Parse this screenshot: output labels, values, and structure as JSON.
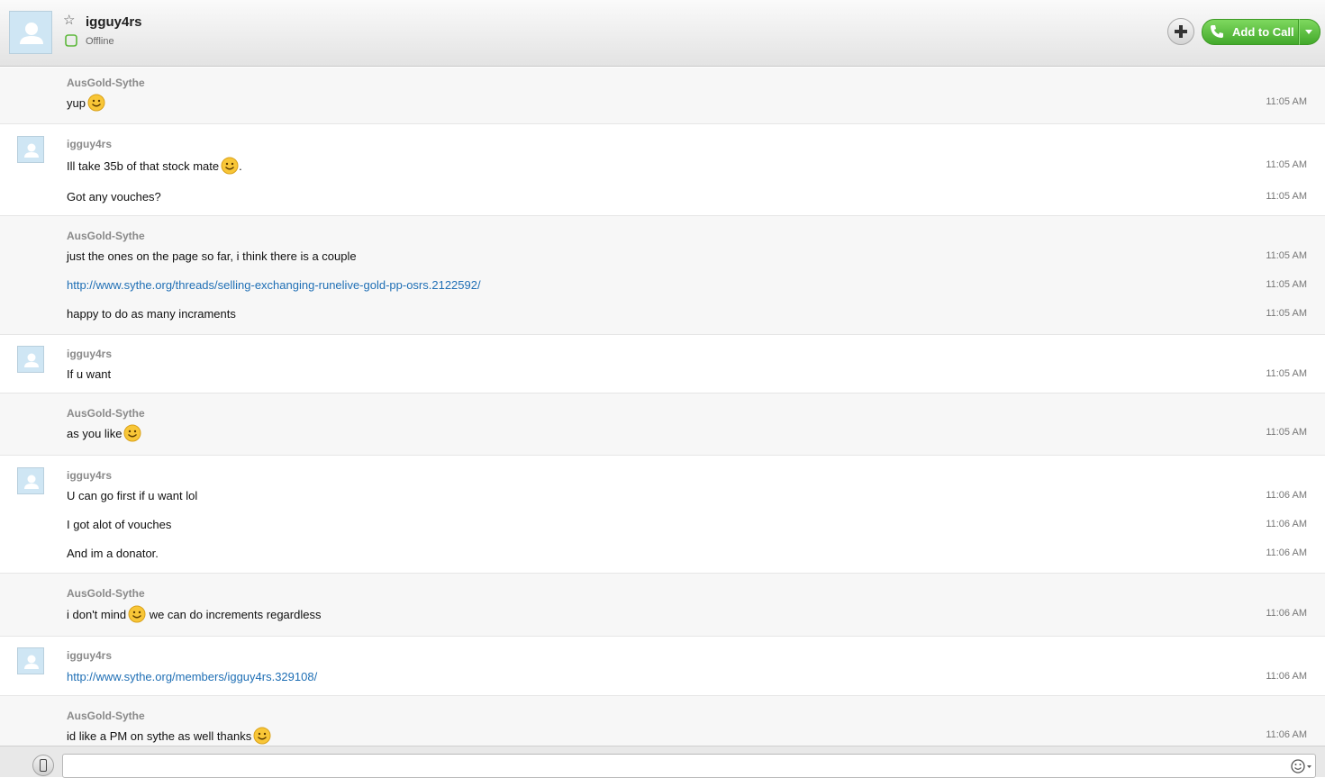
{
  "header": {
    "contact_name": "igguy4rs",
    "status": "Offline",
    "call_label": "Add to Call"
  },
  "messages": [
    {
      "sender": "AusGold-Sythe",
      "role": "other",
      "lines": [
        {
          "text": "yup",
          "smiley": "end",
          "time": "11:05 AM"
        }
      ]
    },
    {
      "sender": "igguy4rs",
      "role": "self",
      "lines": [
        {
          "text": "Ill take 35b of that stock mate",
          "smiley": "end",
          "suffix": ".",
          "time": "11:05 AM"
        },
        {
          "text": "Got any vouches?",
          "time": "11:05 AM"
        }
      ]
    },
    {
      "sender": "AusGold-Sythe",
      "role": "other",
      "lines": [
        {
          "text": "just the ones on the page so far, i think there is a couple",
          "time": "11:05 AM"
        },
        {
          "text": "http://www.sythe.org/threads/selling-exchanging-runelive-gold-pp-osrs.2122592/",
          "link": true,
          "time": "11:05 AM"
        },
        {
          "text": "happy to do as many incraments",
          "time": "11:05 AM"
        }
      ]
    },
    {
      "sender": "igguy4rs",
      "role": "self",
      "lines": [
        {
          "text": "If u want",
          "time": "11:05 AM"
        }
      ]
    },
    {
      "sender": "AusGold-Sythe",
      "role": "other",
      "lines": [
        {
          "text": "as you like",
          "smiley": "end",
          "time": "11:05 AM"
        }
      ]
    },
    {
      "sender": "igguy4rs",
      "role": "self",
      "lines": [
        {
          "text": "U can go first if u want lol",
          "time": "11:06 AM"
        },
        {
          "text": "I got alot of vouches",
          "time": "11:06 AM"
        },
        {
          "text": "And im a donator.",
          "time": "11:06 AM"
        }
      ]
    },
    {
      "sender": "AusGold-Sythe",
      "role": "other",
      "lines": [
        {
          "text": "i don't mind",
          "smiley": "end",
          "suffix": " we can do increments regardless",
          "time": "11:06 AM"
        }
      ]
    },
    {
      "sender": "igguy4rs",
      "role": "self",
      "lines": [
        {
          "text": "http://www.sythe.org/members/igguy4rs.329108/",
          "link": true,
          "time": "11:06 AM"
        }
      ]
    },
    {
      "sender": "AusGold-Sythe",
      "role": "other",
      "lines": [
        {
          "text": "id like a PM on sythe as well thanks",
          "smiley": "end",
          "time": "11:06 AM"
        }
      ]
    }
  ],
  "composer": {
    "input_value": "",
    "phone_icon": "phone-icon",
    "emoticon_icon": "smiley-icon"
  },
  "colors": {
    "call_green": "#4caf30",
    "link_blue": "#1f6fb5",
    "sender_gray": "#8a8a8a"
  }
}
